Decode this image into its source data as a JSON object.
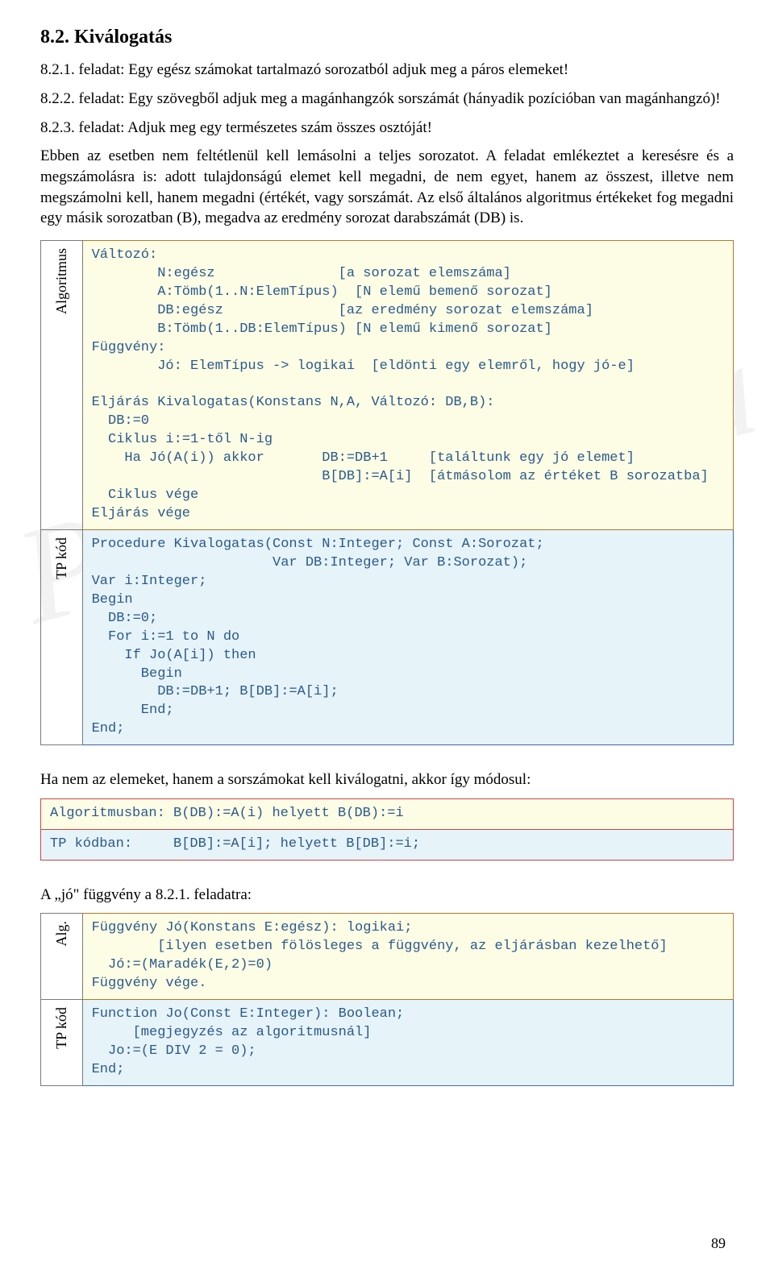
{
  "heading": "8.2. Kiválogatás",
  "task821": "8.2.1. feladat: Egy egész számokat tartalmazó sorozatból adjuk meg a páros elemeket!",
  "task822": "8.2.2. feladat: Egy szövegből adjuk meg a magánhangzók sorszámát (hányadik pozícióban van magánhangzó)!",
  "task823": "8.2.3. feladat: Adjuk meg egy természetes szám összes osztóját!",
  "paragraph": "Ebben az esetben nem feltétlenül kell lemásolni a teljes sorozatot. A feladat emlékeztet a keresésre és a megszámolásra is: adott tulajdonságú elemet kell megadni, de nem egyet, hanem az összest, illetve nem megszámolni kell, hanem megadni (értékét, vagy sorszámát. Az első általános algoritmus értékeket fog megadni egy másik sorozatban (B), megadva az eredmény sorozat darabszámát (DB) is.",
  "labels": {
    "algoritmus": "Algoritmus",
    "tpkod": "TP kód",
    "alg_short": "Alg."
  },
  "alg_code": "Változó:\n        N:egész               [a sorozat elemszáma]\n        A:Tömb(1..N:ElemTípus)  [N elemű bemenő sorozat]\n        DB:egész              [az eredmény sorozat elemszáma]\n        B:Tömb(1..DB:ElemTípus) [N elemű kimenő sorozat]\nFüggvény:\n        Jó: ElemTípus -> logikai  [eldönti egy elemről, hogy jó-e]\n\nEljárás Kivalogatas(Konstans N,A, Változó: DB,B):\n  DB:=0\n  Ciklus i:=1-től N-ig\n    Ha Jó(A(i)) akkor       DB:=DB+1     [találtunk egy jó elemet]\n                            B[DB]:=A[i]  [átmásolom az értéket B sorozatba]\n  Ciklus vége\nEljárás vége",
  "tp_code": "Procedure Kivalogatas(Const N:Integer; Const A:Sorozat;\n                      Var DB:Integer; Var B:Sorozat);\nVar i:Integer;\nBegin\n  DB:=0;\n  For i:=1 to N do\n    If Jo(A[i]) then\n      Begin\n        DB:=DB+1; B[DB]:=A[i];\n      End;\nEnd;",
  "mod_intro": "Ha nem az elemeket, hanem a sorszámokat kell kiválogatni, akkor így módosul:",
  "mod_alg": "Algoritmusban: B(DB):=A(i) helyett B(DB):=i",
  "mod_tp": "TP kódban:     B[DB]:=A[i]; helyett B[DB]:=i;",
  "jo_intro": "A „jó\" függvény a 8.2.1. feladatra:",
  "jo_alg": "Függvény Jó(Konstans E:egész): logikai;\n        [ilyen esetben fölösleges a függvény, az eljárásban kezelhető]\n  Jó:=(Maradék(E,2)=0)\nFüggvény vége.",
  "jo_tp": "Function Jo(Const E:Integer): Boolean;\n     [megjegyzés az algoritmusnál]\n  Jo:=(E DIV 2 = 0);\nEnd;",
  "pagenum": "89"
}
